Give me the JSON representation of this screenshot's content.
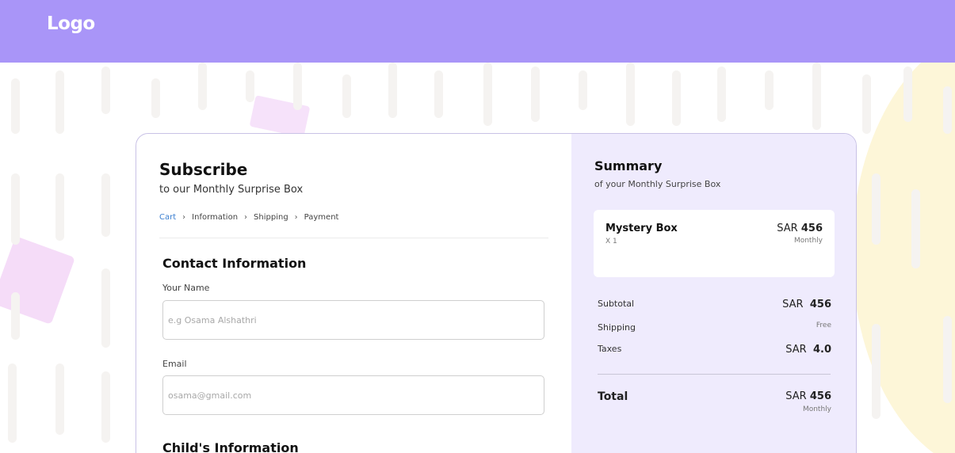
{
  "header": {
    "logo": "Logo"
  },
  "colors": {
    "header_bg": "#a995f8",
    "summary_bg": "#efebfd",
    "accent_link": "#3c7fd0"
  },
  "form": {
    "title": "Subscribe",
    "subtitle": "to our Monthly Surprise Box",
    "breadcrumb": [
      {
        "label": "Cart",
        "active": true
      },
      {
        "label": "Information",
        "active": false
      },
      {
        "label": "Shipping",
        "active": false
      },
      {
        "label": "Payment",
        "active": false
      }
    ],
    "breadcrumb_separator_icon": "chevron-right-icon",
    "contact_section": "Contact Information",
    "name_label": "Your Name",
    "name_placeholder": "e.g Osama Alshathri",
    "name_value": "",
    "email_label": "Email",
    "email_placeholder": "osama@gmail.com",
    "email_value": "",
    "child_section": "Child's Information"
  },
  "summary": {
    "title": "Summary",
    "subtitle": "of your Monthly Surprise Box",
    "item": {
      "name": "Mystery Box",
      "qty": "X 1",
      "currency": "SAR",
      "price": "456",
      "period": "Monthly"
    },
    "subtotal_label": "Subtotal",
    "subtotal_currency": "SAR",
    "subtotal_value": "456",
    "shipping_label": "Shipping",
    "shipping_value": "Free",
    "taxes_label": "Taxes",
    "taxes_currency": "SAR",
    "taxes_value": "4.0",
    "total_label": "Total",
    "total_currency": "SAR",
    "total_value": "456",
    "total_period": "Monthly"
  }
}
